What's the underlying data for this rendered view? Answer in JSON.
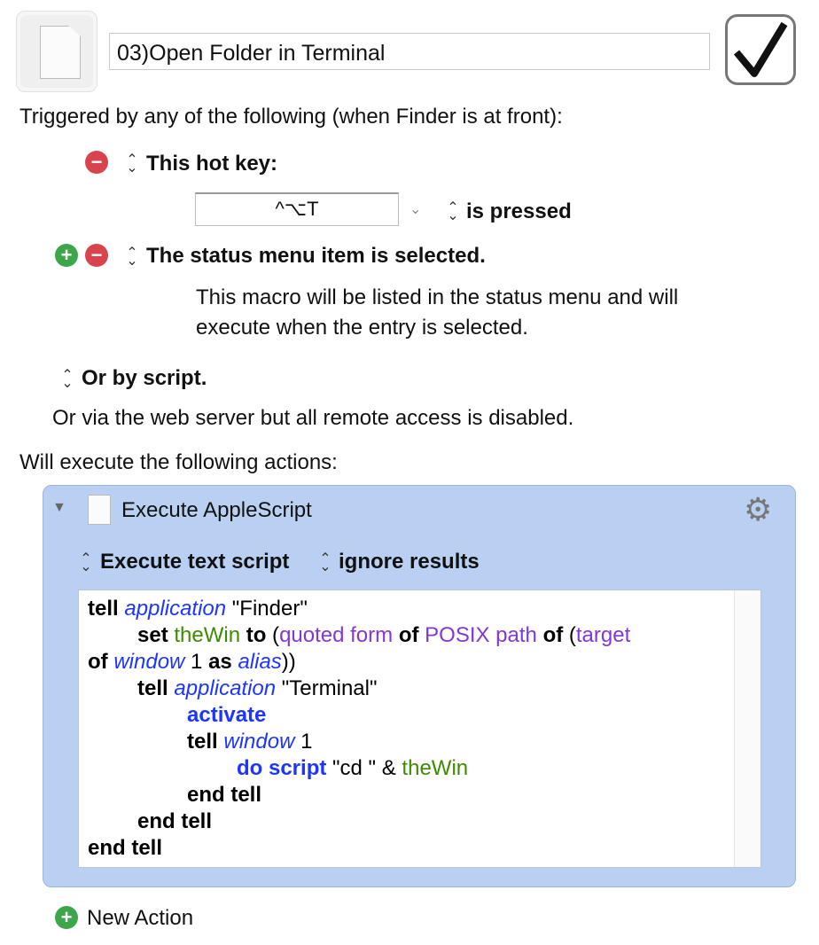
{
  "macro": {
    "name": "03)Open Folder in Terminal",
    "enabled": true,
    "icon": "applescript-document-icon"
  },
  "triggers": {
    "heading": "Triggered by any of the following (when Finder is at front):",
    "hotkey_label": "This hot key:",
    "hotkey_value": "^⌥T",
    "hotkey_mode": "is pressed",
    "status_menu_label": "The status menu item is selected.",
    "status_menu_desc_1": "This macro will be listed in the status menu and will",
    "status_menu_desc_2": "execute when the entry is selected.",
    "script_label": "Or by script.",
    "web_server_note": "Or via the web server but all remote access is disabled."
  },
  "actions": {
    "heading": "Will execute the following actions:",
    "items": [
      {
        "title": "Execute AppleScript",
        "mode": "Execute text script",
        "results": "ignore results"
      }
    ],
    "new_action": "New Action"
  },
  "code_colors": {
    "keyword": "#000000",
    "class": "#1e35ff",
    "property": "#8237d6",
    "variable": "#3d8c00",
    "command": "#1e35ff"
  },
  "code": [
    {
      "indent": 0,
      "tokens": [
        [
          "kw",
          "tell"
        ],
        [
          "plain",
          " "
        ],
        [
          "cls",
          "application"
        ],
        [
          "plain",
          " \"Finder\""
        ]
      ]
    },
    {
      "indent": 1,
      "tokens": [
        [
          "kw",
          "set"
        ],
        [
          "plain",
          " "
        ],
        [
          "var",
          "theWin"
        ],
        [
          "plain",
          " "
        ],
        [
          "kw",
          "to"
        ],
        [
          "plain",
          " ("
        ],
        [
          "prop",
          "quoted form"
        ],
        [
          "plain",
          " "
        ],
        [
          "kw",
          "of"
        ],
        [
          "plain",
          " "
        ],
        [
          "prop",
          "POSIX path"
        ],
        [
          "plain",
          " "
        ],
        [
          "kw",
          "of"
        ],
        [
          "plain",
          " ("
        ],
        [
          "prop",
          "target"
        ]
      ]
    },
    {
      "indent": 0,
      "tokens": [
        [
          "kw",
          "of"
        ],
        [
          "plain",
          " "
        ],
        [
          "cls",
          "window"
        ],
        [
          "plain",
          " 1 "
        ],
        [
          "kw",
          "as"
        ],
        [
          "plain",
          " "
        ],
        [
          "cls",
          "alias"
        ],
        [
          "plain",
          "))"
        ]
      ]
    },
    {
      "indent": 1,
      "tokens": [
        [
          "kw",
          "tell"
        ],
        [
          "plain",
          " "
        ],
        [
          "cls",
          "application"
        ],
        [
          "plain",
          " \"Terminal\""
        ]
      ]
    },
    {
      "indent": 2,
      "tokens": [
        [
          "cmd",
          "activate"
        ]
      ]
    },
    {
      "indent": 2,
      "tokens": [
        [
          "kw",
          "tell"
        ],
        [
          "plain",
          " "
        ],
        [
          "cls",
          "window"
        ],
        [
          "plain",
          " 1"
        ]
      ]
    },
    {
      "indent": 3,
      "tokens": [
        [
          "cmd",
          "do script"
        ],
        [
          "plain",
          " \"cd \" & "
        ],
        [
          "var",
          "theWin"
        ]
      ]
    },
    {
      "indent": 2,
      "tokens": [
        [
          "kw",
          "end tell"
        ]
      ]
    },
    {
      "indent": 1,
      "tokens": [
        [
          "kw",
          "end tell"
        ]
      ]
    },
    {
      "indent": 0,
      "tokens": [
        [
          "kw",
          "end tell"
        ]
      ]
    }
  ]
}
